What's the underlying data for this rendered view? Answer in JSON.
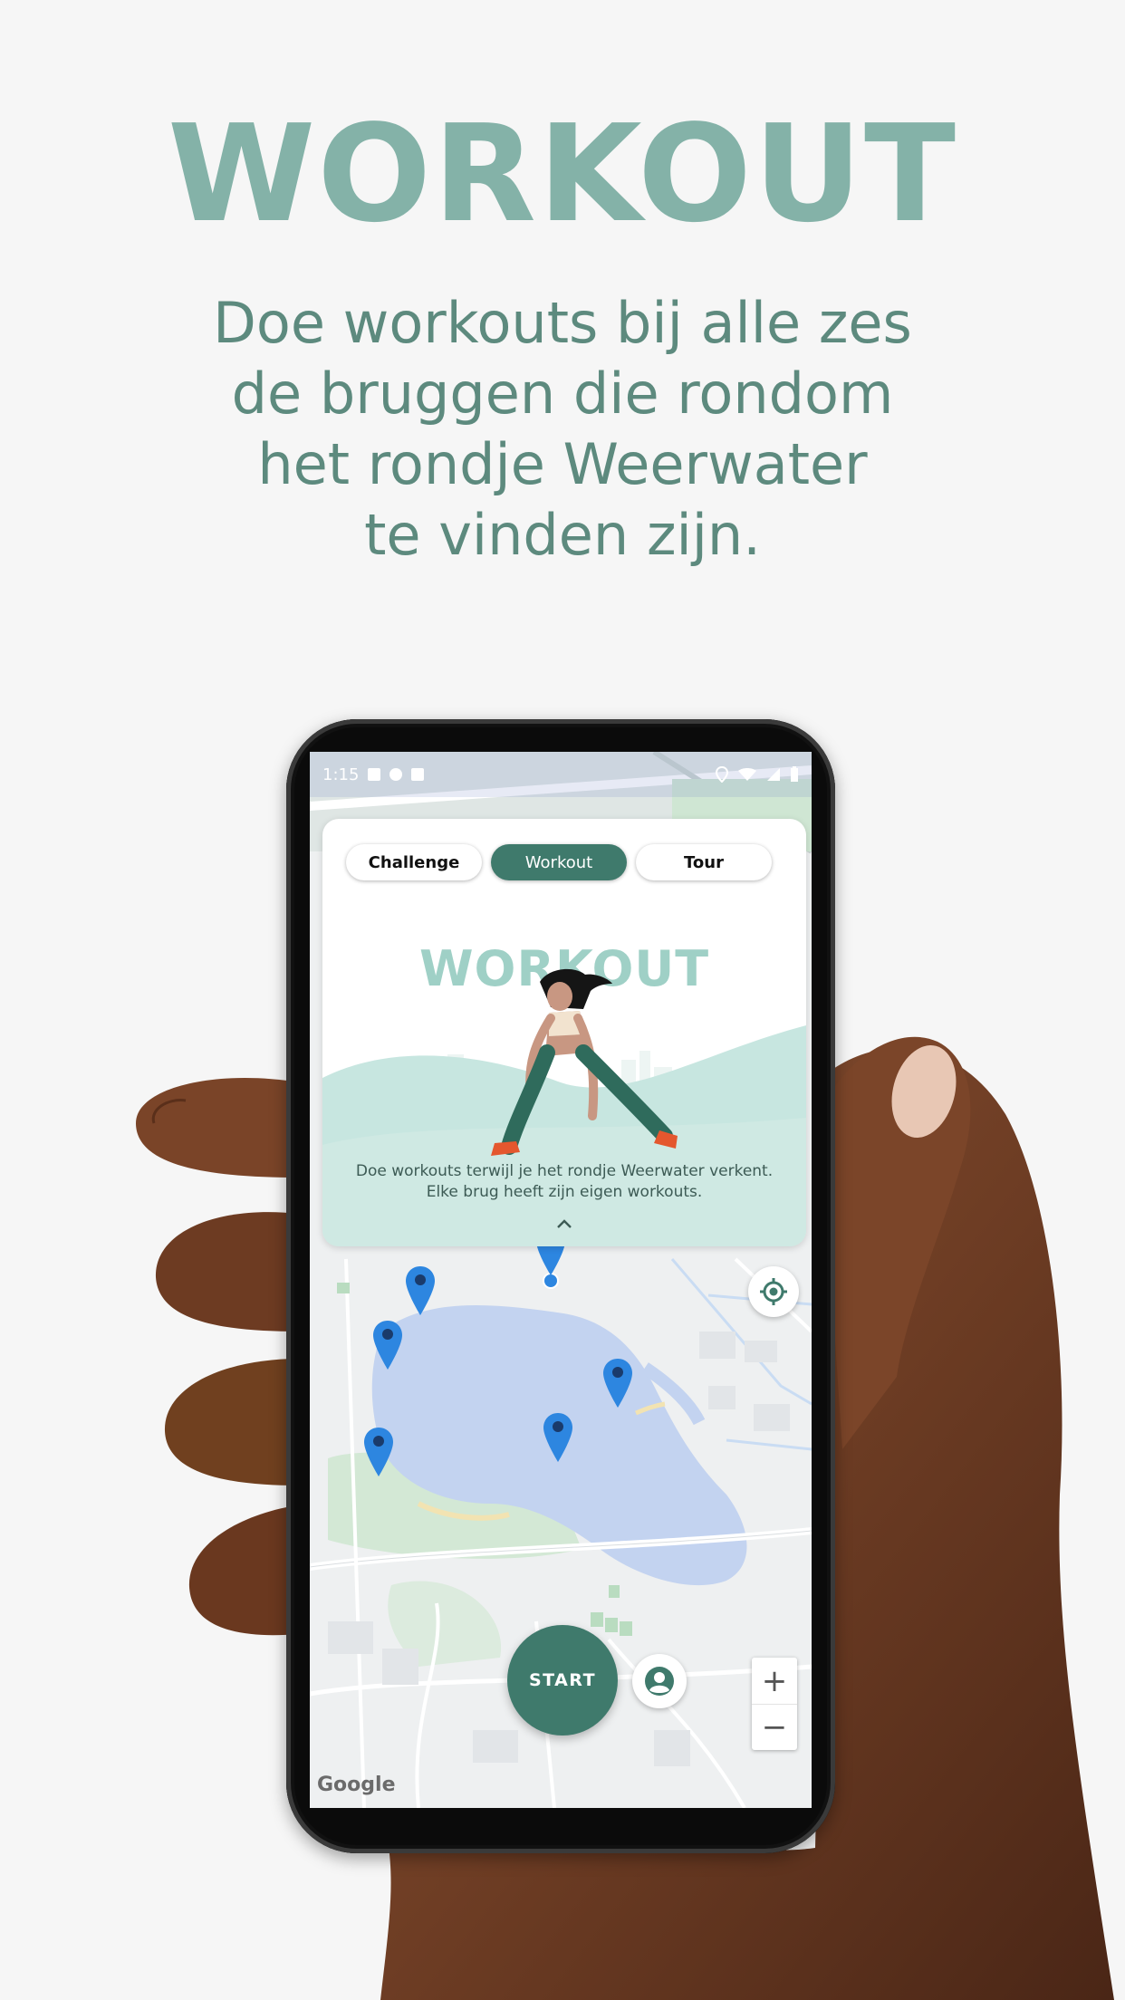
{
  "promo": {
    "title": "WORKOUT",
    "subtitle_lines": [
      "Doe workouts bij alle zes",
      "de bruggen die rondom",
      "het rondje Weerwater",
      "te vinden zijn."
    ]
  },
  "status_bar": {
    "time": "1:15"
  },
  "tabs": [
    {
      "label": "Challenge",
      "active": false
    },
    {
      "label": "Workout",
      "active": true
    },
    {
      "label": "Tour",
      "active": false
    }
  ],
  "card": {
    "title": "WORKOUT",
    "description_lines": [
      "Doe workouts terwijl je het rondje Weerwater verkent.",
      "Elke brug heeft zijn eigen workouts."
    ]
  },
  "map": {
    "start_label": "START",
    "zoom_in": "+",
    "zoom_out": "−",
    "attribution": "Google",
    "pin_count": 6
  },
  "colors": {
    "accent": "#3f7a6c",
    "promo_title": "#84b2a8",
    "card_title": "#9fd0c6",
    "water": "#c3d3f0",
    "park": "#cfe6d3",
    "pin": "#2d86e0"
  },
  "icons": [
    "locate-icon",
    "profile-icon",
    "chevron-up-icon",
    "map-pin-icon",
    "wifi-icon",
    "signal-icon",
    "battery-icon",
    "location-status-icon"
  ]
}
